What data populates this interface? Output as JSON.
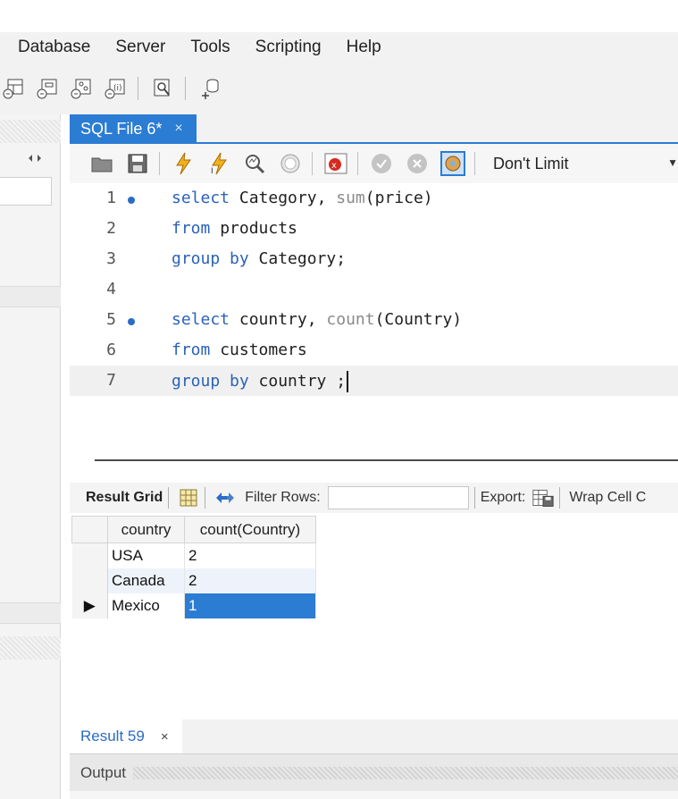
{
  "menu": {
    "items": [
      "Database",
      "Server",
      "Tools",
      "Scripting",
      "Help"
    ]
  },
  "main_toolbar": {
    "icons": [
      "new-table-icon",
      "new-view-icon",
      "new-procedure-icon",
      "new-function-icon",
      "search-table-icon",
      "reconnect-icon"
    ]
  },
  "document_tab": {
    "label": "SQL File 6*",
    "close": "×"
  },
  "sql_toolbar": {
    "icons": [
      "open-file-icon",
      "save-icon",
      "execute-icon",
      "execute-current-icon",
      "explain-icon",
      "stop-icon",
      "toggle-error-icon",
      "commit-icon",
      "rollback-icon",
      "autocommit-icon"
    ],
    "limit_value": "Don't Limit"
  },
  "editor": {
    "lines": [
      {
        "num": "1",
        "marker": true
      },
      {
        "num": "2",
        "marker": false
      },
      {
        "num": "3",
        "marker": false
      },
      {
        "num": "4",
        "marker": false
      },
      {
        "num": "5",
        "marker": true
      },
      {
        "num": "6",
        "marker": false
      },
      {
        "num": "7",
        "marker": false
      }
    ],
    "tokens": {
      "l1_kw": "select",
      "l1_rest": " Category, ",
      "l1_fn": "sum",
      "l1_tail": "(price)",
      "l2_kw": "from",
      "l2_rest": " products",
      "l3_kw": "group by",
      "l3_rest": " Category;",
      "l5_kw": "select",
      "l5_rest": " country, ",
      "l5_fn": "count",
      "l5_tail": "(Country)",
      "l6_kw": "from",
      "l6_rest": " customers",
      "l7_kw": "group by",
      "l7_rest": " country ;"
    }
  },
  "result_toolbar": {
    "result_grid_label": "Result Grid",
    "filter_label": "Filter Rows:",
    "filter_value": "",
    "export_label": "Export:",
    "wrap_label": "Wrap Cell C"
  },
  "result_grid": {
    "columns": [
      "country",
      "count(Country)"
    ],
    "rows": [
      {
        "country": "USA",
        "count": "2"
      },
      {
        "country": "Canada",
        "count": "2"
      },
      {
        "country": "Mexico",
        "count": "1"
      }
    ],
    "current_row_marker": "▶"
  },
  "result_tab": {
    "label": "Result 59",
    "close": "×"
  },
  "output": {
    "label": "Output"
  },
  "colors": {
    "accent": "#2b7cd3",
    "keyword": "#2b62b8",
    "function": "#8a8a8a"
  }
}
